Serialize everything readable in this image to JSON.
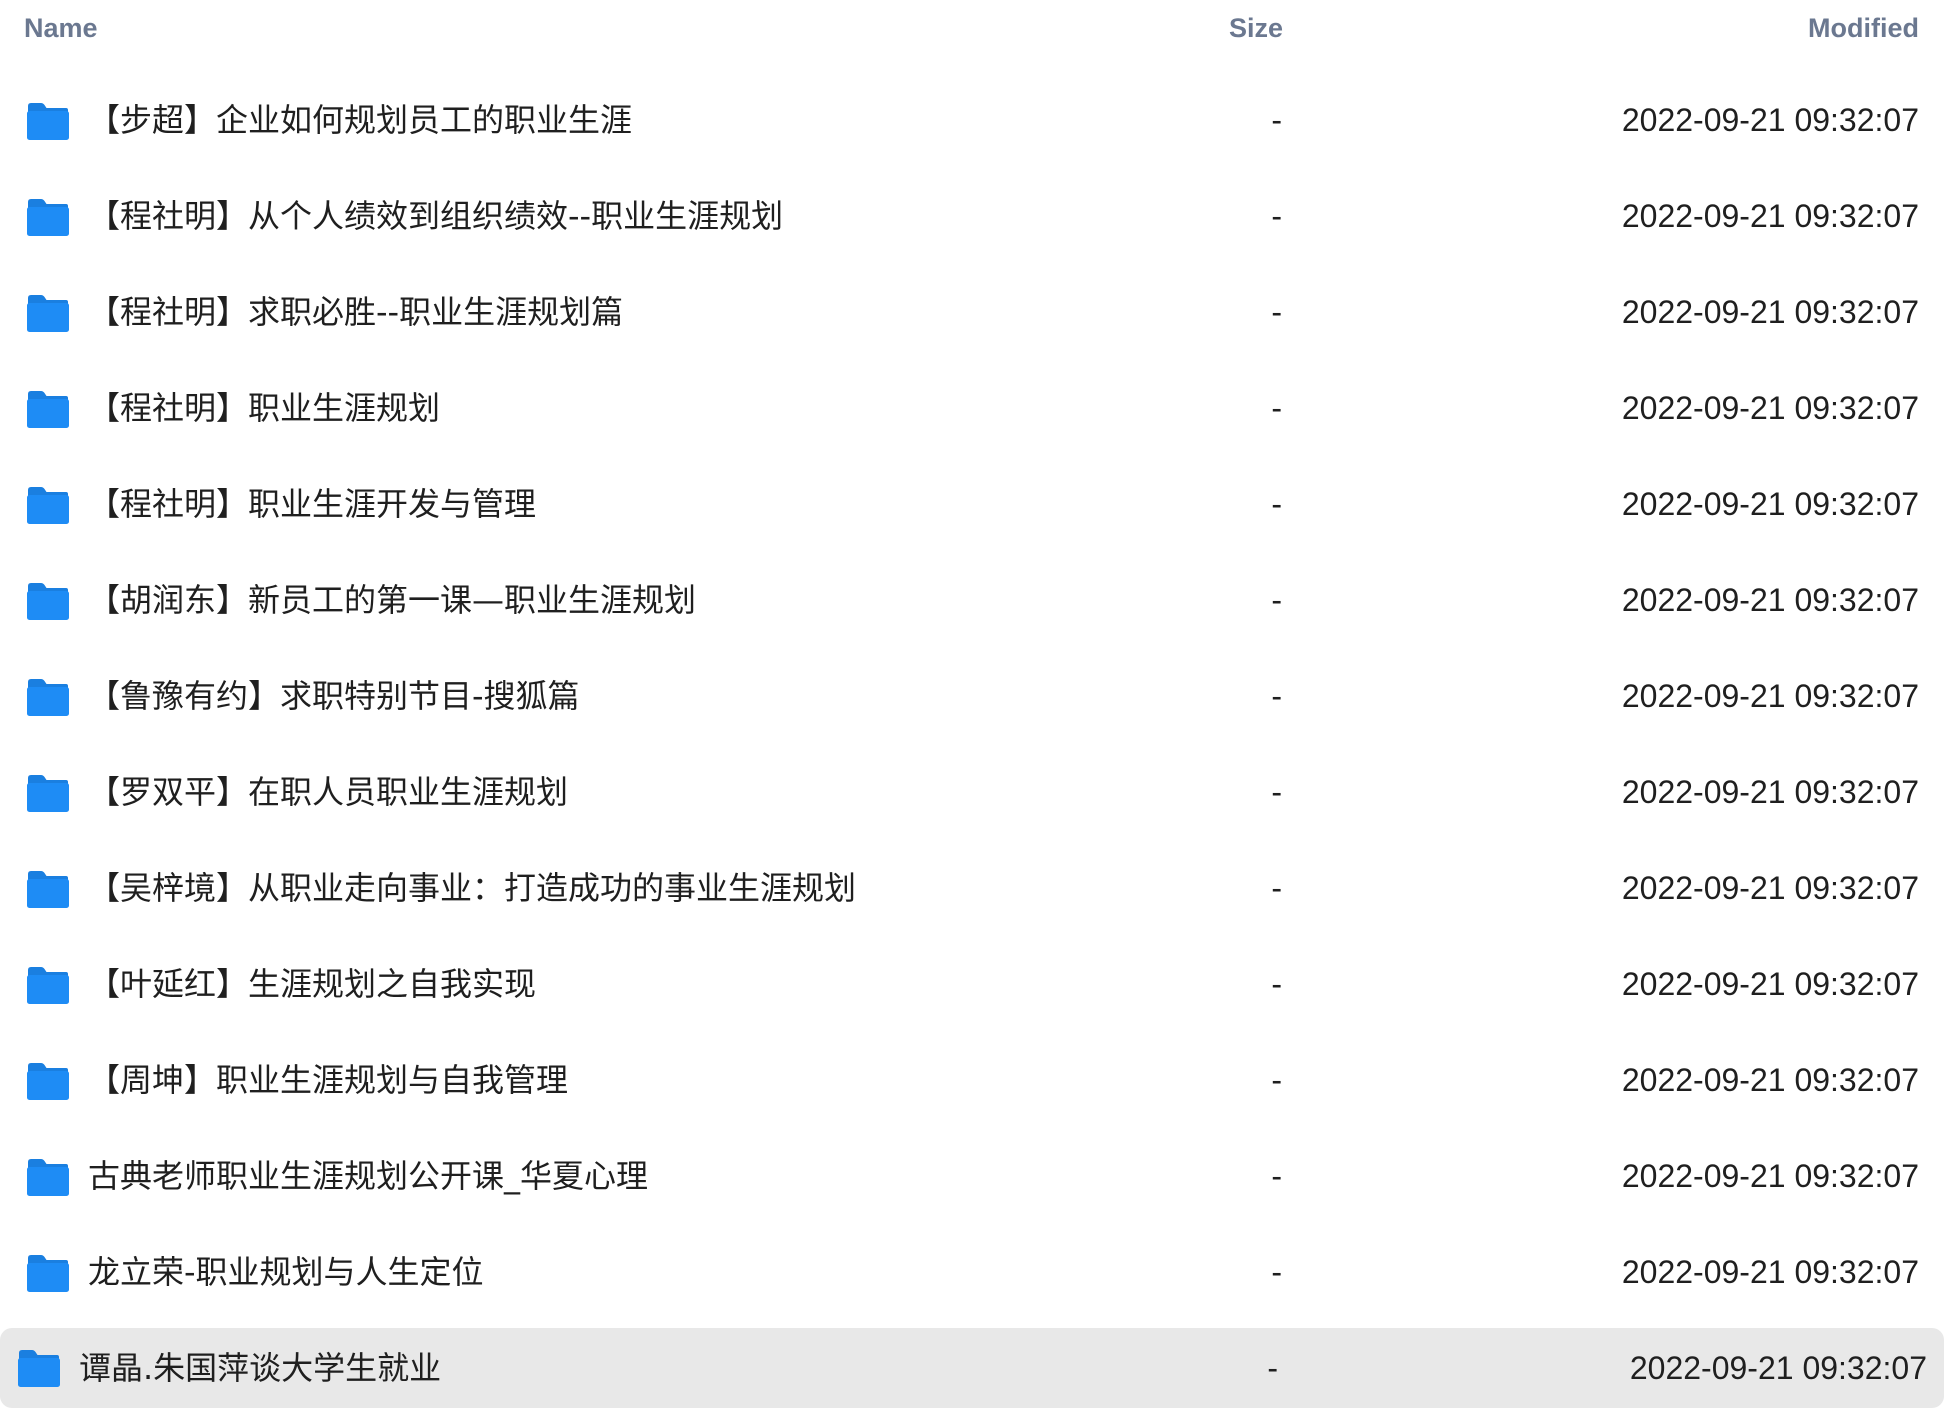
{
  "header": {
    "name": "Name",
    "size": "Size",
    "modified": "Modified"
  },
  "colors": {
    "folder": "#1e8cf5",
    "folder_tab": "#1a7fe0",
    "header_text": "#6b7890",
    "selected_row_bg": "#e8e8e8"
  },
  "icon": "folder-icon",
  "rows": [
    {
      "name": "【步超】企业如何规划员工的职业生涯",
      "size": "-",
      "modified": "2022-09-21 09:32:07"
    },
    {
      "name": "【程社明】从个人绩效到组织绩效--职业生涯规划",
      "size": "-",
      "modified": "2022-09-21 09:32:07"
    },
    {
      "name": "【程社明】求职必胜--职业生涯规划篇",
      "size": "-",
      "modified": "2022-09-21 09:32:07"
    },
    {
      "name": "【程社明】职业生涯规划",
      "size": "-",
      "modified": "2022-09-21 09:32:07"
    },
    {
      "name": "【程社明】职业生涯开发与管理",
      "size": "-",
      "modified": "2022-09-21 09:32:07"
    },
    {
      "name": "【胡润东】新员工的第一课—职业生涯规划",
      "size": "-",
      "modified": "2022-09-21 09:32:07"
    },
    {
      "name": "【鲁豫有约】求职特别节目-搜狐篇",
      "size": "-",
      "modified": "2022-09-21 09:32:07"
    },
    {
      "name": "【罗双平】在职人员职业生涯规划",
      "size": "-",
      "modified": "2022-09-21 09:32:07"
    },
    {
      "name": "【吴梓境】从职业走向事业：打造成功的事业生涯规划",
      "size": "-",
      "modified": "2022-09-21 09:32:07"
    },
    {
      "name": "【叶延红】生涯规划之自我实现",
      "size": "-",
      "modified": "2022-09-21 09:32:07"
    },
    {
      "name": "【周坤】职业生涯规划与自我管理",
      "size": "-",
      "modified": "2022-09-21 09:32:07"
    },
    {
      "name": "古典老师职业生涯规划公开课_华夏心理",
      "size": "-",
      "modified": "2022-09-21 09:32:07"
    },
    {
      "name": "龙立荣-职业规划与人生定位",
      "size": "-",
      "modified": "2022-09-21 09:32:07"
    },
    {
      "name": "谭晶.朱国萍谈大学生就业",
      "size": "-",
      "modified": "2022-09-21 09:32:07",
      "selected": true
    }
  ]
}
